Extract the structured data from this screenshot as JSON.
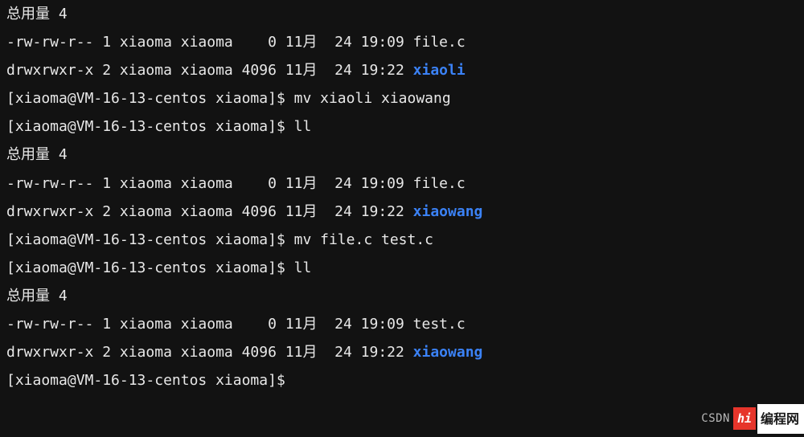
{
  "lines": [
    {
      "segments": [
        {
          "t": "总用量 4"
        }
      ]
    },
    {
      "segments": [
        {
          "t": "-rw-rw-r-- 1 xiaoma xiaoma    0 11月  24 19:09 file.c"
        }
      ]
    },
    {
      "segments": [
        {
          "t": "drwxrwxr-x 2 xiaoma xiaoma 4096 11月  24 19:22 "
        },
        {
          "t": "xiaoli",
          "cls": "dir-highlight"
        }
      ]
    },
    {
      "segments": [
        {
          "t": "[xiaoma@VM-16-13-centos xiaoma]$ mv xiaoli xiaowang"
        }
      ]
    },
    {
      "segments": [
        {
          "t": "[xiaoma@VM-16-13-centos xiaoma]$ ll"
        }
      ]
    },
    {
      "segments": [
        {
          "t": "总用量 4"
        }
      ]
    },
    {
      "segments": [
        {
          "t": "-rw-rw-r-- 1 xiaoma xiaoma    0 11月  24 19:09 file.c"
        }
      ]
    },
    {
      "segments": [
        {
          "t": "drwxrwxr-x 2 xiaoma xiaoma 4096 11月  24 19:22 "
        },
        {
          "t": "xiaowang",
          "cls": "dir-highlight"
        }
      ]
    },
    {
      "segments": [
        {
          "t": "[xiaoma@VM-16-13-centos xiaoma]$ mv file.c test.c"
        }
      ]
    },
    {
      "segments": [
        {
          "t": "[xiaoma@VM-16-13-centos xiaoma]$ ll"
        }
      ]
    },
    {
      "segments": [
        {
          "t": "总用量 4"
        }
      ]
    },
    {
      "segments": [
        {
          "t": "-rw-rw-r-- 1 xiaoma xiaoma    0 11月  24 19:09 test.c"
        }
      ]
    },
    {
      "segments": [
        {
          "t": "drwxrwxr-x 2 xiaoma xiaoma 4096 11月  24 19:22 "
        },
        {
          "t": "xiaowang",
          "cls": "dir-highlight"
        }
      ]
    },
    {
      "segments": [
        {
          "t": "[xiaoma@VM-16-13-centos xiaoma]$ "
        }
      ]
    }
  ],
  "watermark": {
    "csdn": "CSDN",
    "logo": "hi",
    "site": "编程网"
  }
}
